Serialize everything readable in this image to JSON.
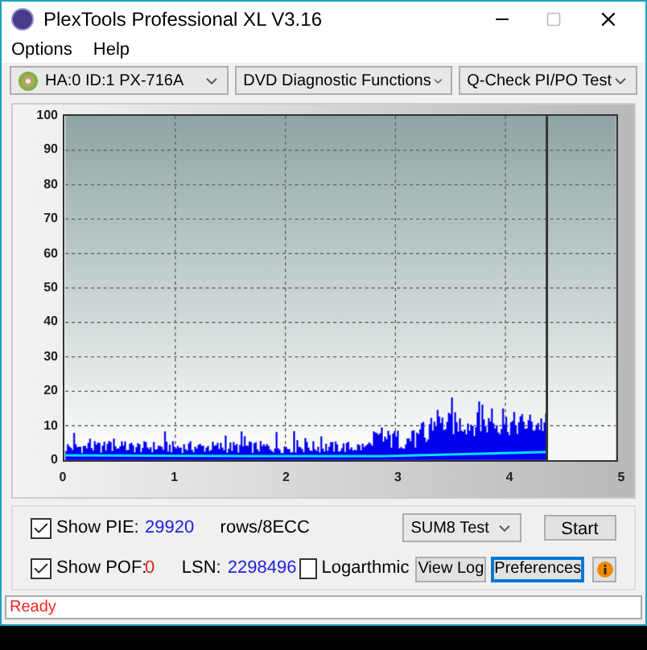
{
  "window": {
    "title": "PlexTools Professional XL V3.16"
  },
  "menu": [
    "Options",
    "Help"
  ],
  "toolbar": {
    "drive": "HA:0 ID:1  PX-716A",
    "function": "DVD Diagnostic Functions",
    "test": "Q-Check PI/PO Test"
  },
  "chart": {
    "yticks": [
      "100",
      "90",
      "80",
      "70",
      "60",
      "50",
      "40",
      "30",
      "20",
      "10",
      "0"
    ],
    "xticks": [
      "0",
      "1",
      "2",
      "3",
      "4",
      "5"
    ]
  },
  "controls": {
    "show_pie": {
      "label": "Show PIE:",
      "checked": true,
      "value": "29920"
    },
    "unit": "rows/8ECC",
    "show_pof": {
      "label": "Show POF:",
      "checked": true,
      "value": "0"
    },
    "lsn_label": "LSN:",
    "lsn": "2298496",
    "logarithmic": {
      "label": "Logarthmic",
      "checked": false
    },
    "test_select": "SUM8 Test",
    "start": "Start",
    "view_log": "View Log",
    "preferences": "Preferences"
  },
  "status": "Ready"
}
